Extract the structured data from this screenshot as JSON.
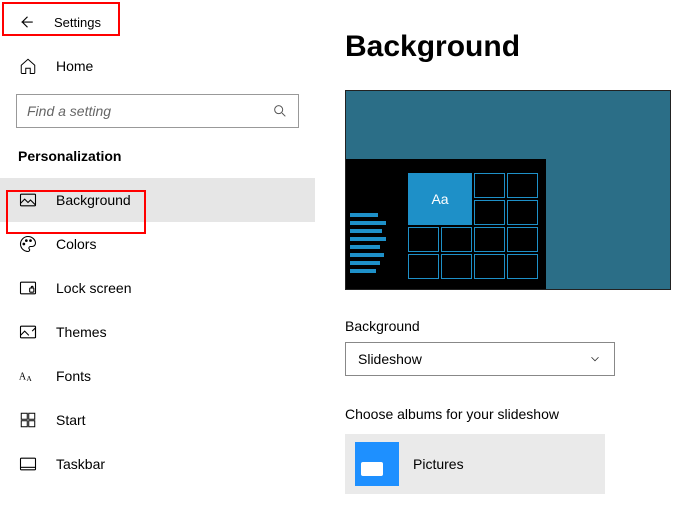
{
  "header": {
    "title": "Settings"
  },
  "home": {
    "label": "Home"
  },
  "search": {
    "placeholder": "Find a setting"
  },
  "section": {
    "title": "Personalization"
  },
  "nav": {
    "background": "Background",
    "colors": "Colors",
    "lockscreen": "Lock screen",
    "themes": "Themes",
    "fonts": "Fonts",
    "start": "Start",
    "taskbar": "Taskbar"
  },
  "page": {
    "title": "Background",
    "preview_sample": "Aa",
    "bg_label": "Background",
    "bg_value": "Slideshow",
    "album_label": "Choose albums for your slideshow",
    "album_name": "Pictures"
  }
}
